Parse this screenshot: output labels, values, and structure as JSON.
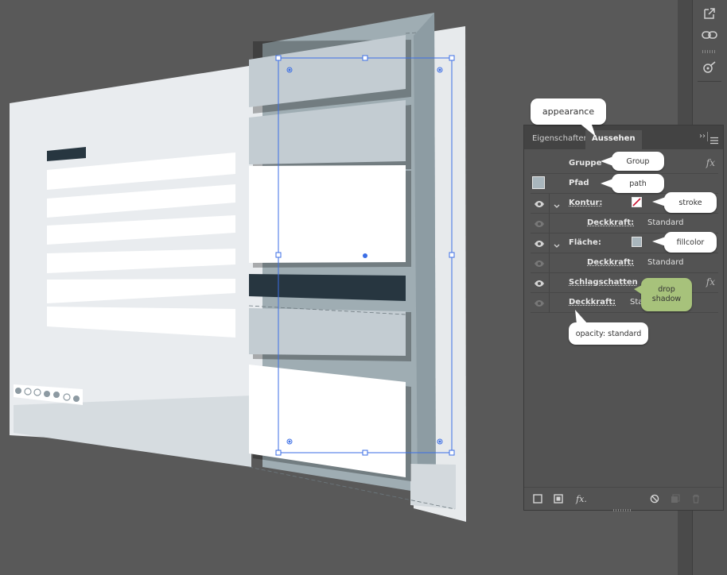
{
  "panel": {
    "tabs": [
      {
        "label": "Eigenschaften",
        "active": false
      },
      {
        "label": "Aussehen",
        "active": true
      }
    ],
    "expand_icon": "double-chevron-right-icon",
    "menu_icon": "hamburger-menu-icon",
    "rows": [
      {
        "label": "Gruppe"
      },
      {
        "label": "Pfad"
      },
      {
        "label": "Kontur:"
      },
      {
        "label": "Deckkraft:",
        "value": "Standard"
      },
      {
        "label": "Fläche:"
      },
      {
        "label": "Deckkraft:",
        "value": "Standard"
      },
      {
        "label": "Schlagschatten"
      },
      {
        "label": "Deckkraft:",
        "value": "Standard"
      }
    ],
    "fx_label": "fx",
    "bottom_fx_label": "fx.",
    "colors": {
      "stroke_swatch": "#ffffff",
      "stroke_slash": "#c8102e",
      "fill_swatch": "#a9b6bd"
    }
  },
  "callouts": {
    "appearance": "appearance",
    "group": "Group",
    "path": "path",
    "stroke": "stroke",
    "fillcolor": "fillcolor",
    "drop_shadow_1": "drop",
    "drop_shadow_2": "shadow",
    "opacity": "opacity: standard"
  },
  "toolbar": {
    "icons": [
      "export-icon",
      "link-icon",
      "puppet-warp-icon"
    ]
  },
  "colors": {
    "canvas_bg": "#595959",
    "artboard": "#e9ecef",
    "strip_light": "#c3ccd2",
    "strip_dark": "#273640",
    "strip_white": "#ffffff",
    "backing": "#9fadb3",
    "selection": "#3b6ee6",
    "callout_green": "#a7c27b"
  }
}
